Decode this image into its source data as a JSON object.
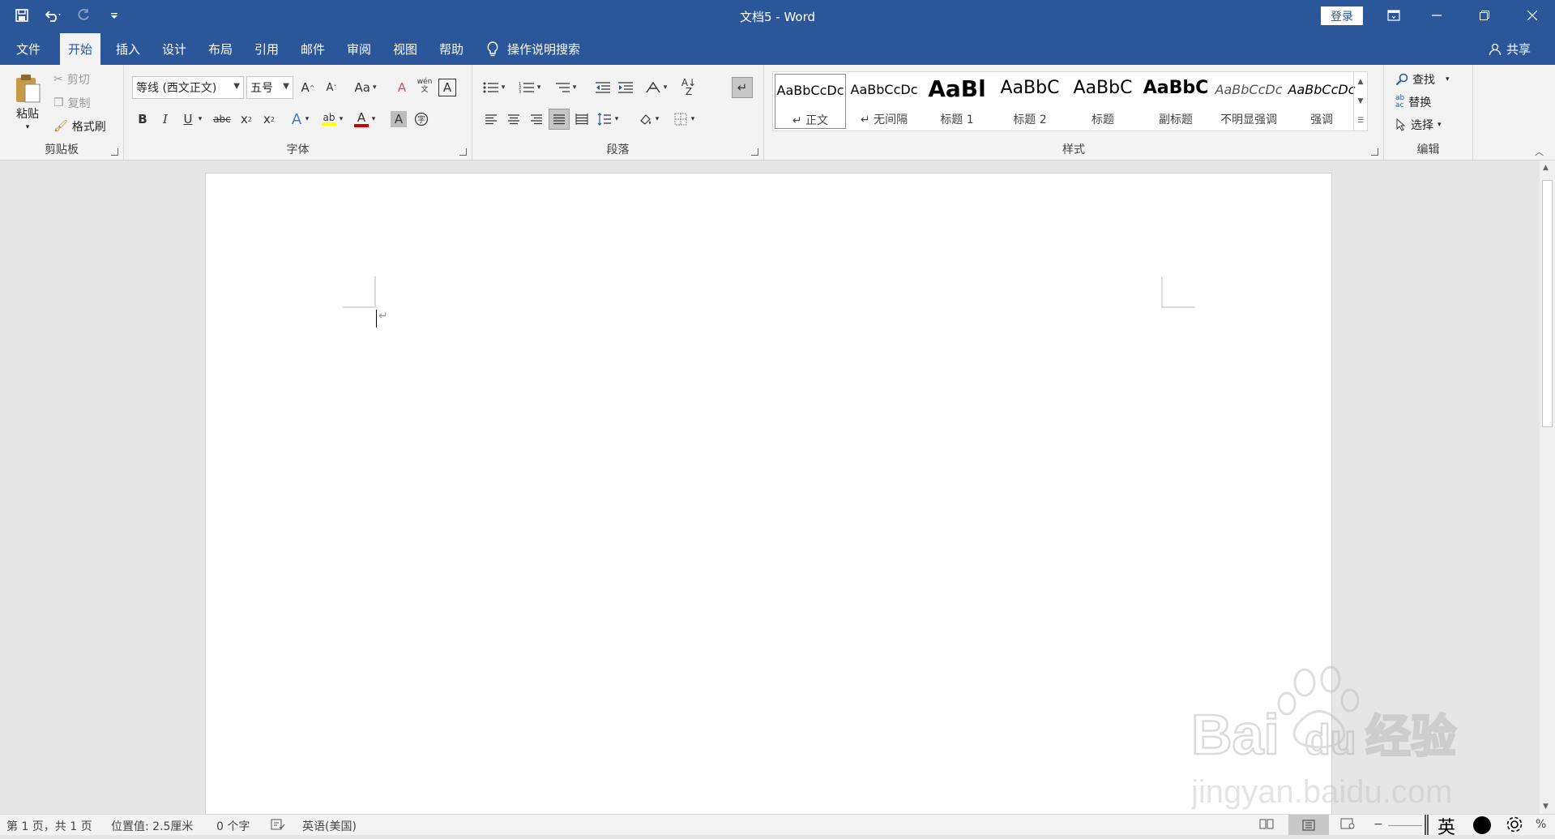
{
  "window": {
    "title": "文档5  -  Word",
    "login_label": "登录"
  },
  "tabs": [
    {
      "label": "文件"
    },
    {
      "label": "开始"
    },
    {
      "label": "插入"
    },
    {
      "label": "设计"
    },
    {
      "label": "布局"
    },
    {
      "label": "引用"
    },
    {
      "label": "邮件"
    },
    {
      "label": "审阅"
    },
    {
      "label": "视图"
    },
    {
      "label": "帮助"
    }
  ],
  "active_tab": "开始",
  "tell_me": "操作说明搜索",
  "share": "共享",
  "clipboard": {
    "label": "剪贴板",
    "paste": "粘贴",
    "cut": "剪切",
    "copy": "复制",
    "format_painter": "格式刷"
  },
  "font": {
    "label": "字体",
    "font_name": "等线 (西文正文)",
    "font_size": "五号",
    "change_case": "Aa",
    "phonetic": "wén 文"
  },
  "paragraph": {
    "label": "段落"
  },
  "styles": {
    "label": "样式",
    "items": [
      {
        "preview": "AaBbCcDc",
        "name": "↵ 正文"
      },
      {
        "preview": "AaBbCcDc",
        "name": "↵ 无间隔"
      },
      {
        "preview": "AaBl",
        "name": "标题 1"
      },
      {
        "preview": "AaBbC",
        "name": "标题 2"
      },
      {
        "preview": "AaBbC",
        "name": "标题"
      },
      {
        "preview": "AaBbC",
        "name": "副标题"
      },
      {
        "preview": "AaBbCcDc",
        "name": "不明显强调"
      },
      {
        "preview": "AaBbCcDc",
        "name": "强调"
      }
    ]
  },
  "editing": {
    "label": "编辑",
    "find": "查找",
    "replace": "替换",
    "select": "选择"
  },
  "status": {
    "page": "第 1 页，共 1 页",
    "position": "位置值: 2.5厘米",
    "words": "0 个字",
    "language": "英语(美国)",
    "zoom_suffix": "%",
    "ime_mode": "英"
  },
  "watermark": {
    "brand": "Bai",
    "brand2": "du",
    "cn": "经验",
    "url": "jingyan.baidu.com"
  },
  "colors": {
    "brand": "#2b579a",
    "ribbon": "#f3f3f3",
    "canvas": "#e6e6e6",
    "font_color": "#d00000",
    "highlight": "#ffff00"
  }
}
